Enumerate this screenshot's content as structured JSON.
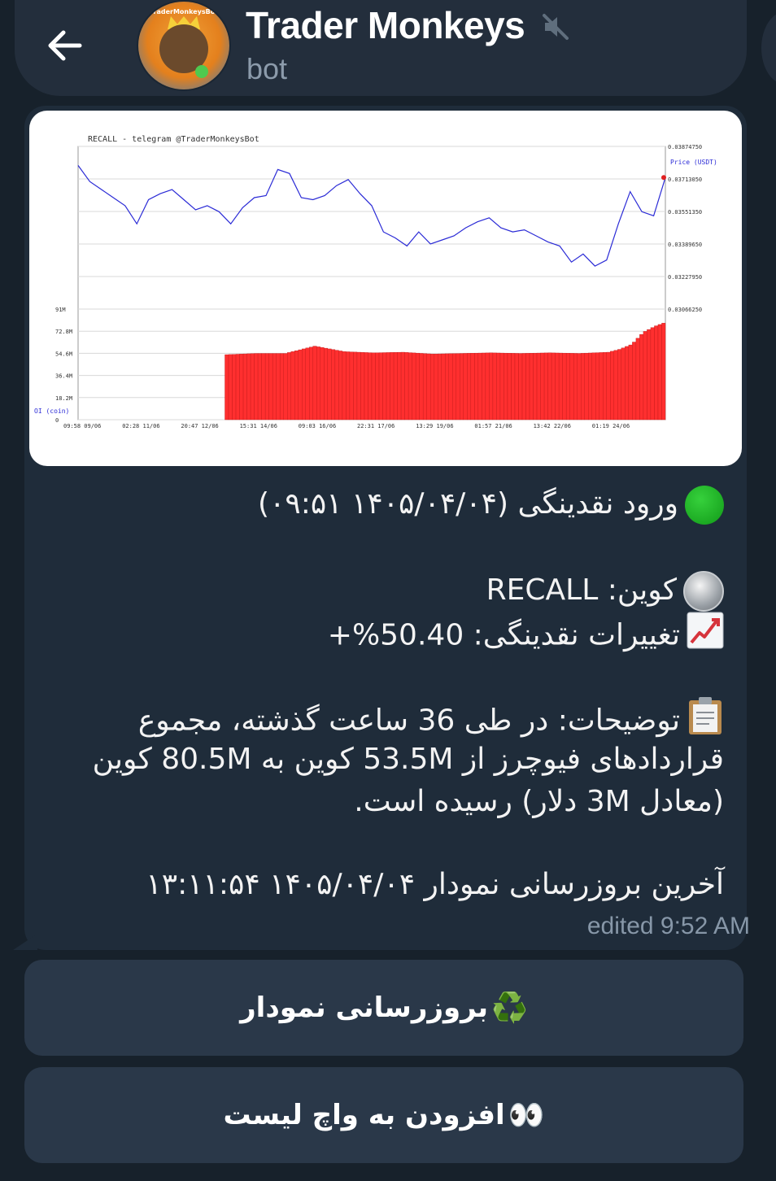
{
  "header": {
    "title": "Trader Monkeys",
    "subtitle": "bot",
    "avatar_text": "TraderMonkeysBot"
  },
  "chart": {
    "title": "RECALL - telegram @TraderMonkeysBot",
    "price_axis_label": "Price (USDT)",
    "oi_axis_label": "OI (coin)",
    "chart_data": {
      "type": "line",
      "title": "RECALL - telegram @TraderMonkeysBot",
      "price_ticks": [
        "0.03874750",
        "0.03713050",
        "0.03551350",
        "0.03389650",
        "0.03227950",
        "0.03066250"
      ],
      "oi_ticks": [
        "91M",
        "72.8M",
        "54.6M",
        "36.4M",
        "18.2M",
        "0"
      ],
      "x_ticks": [
        "09:58 09/06",
        "02:28 11/06",
        "20:47 12/06",
        "15:31 14/06",
        "09:03 16/06",
        "22:31 17/06",
        "13:29 19/06",
        "01:57 21/06",
        "13:42 22/06",
        "01:19 24/06"
      ],
      "price_range": [
        0.0306625,
        0.0387475
      ],
      "oi_range": [
        0,
        91
      ],
      "price_series": {
        "name": "Price (USDT)",
        "color": "#2b2bd6",
        "x": [
          0,
          2,
          4,
          6,
          8,
          10,
          12,
          14,
          16,
          18,
          20,
          22,
          24,
          26,
          28,
          30,
          32,
          34,
          36,
          38,
          40,
          42,
          44,
          46,
          48,
          50,
          52,
          54,
          56,
          58,
          60,
          62,
          64,
          66,
          68,
          70,
          72,
          74,
          76,
          78,
          80,
          82,
          84,
          86,
          88,
          90,
          92,
          94,
          96,
          98,
          100
        ],
        "y": [
          0.0378,
          0.037,
          0.0366,
          0.0362,
          0.0358,
          0.0349,
          0.0361,
          0.0364,
          0.0366,
          0.0361,
          0.0356,
          0.0358,
          0.0355,
          0.0349,
          0.0357,
          0.0362,
          0.0363,
          0.0376,
          0.0374,
          0.0362,
          0.0361,
          0.0363,
          0.0368,
          0.0371,
          0.0364,
          0.0358,
          0.0345,
          0.0342,
          0.0338,
          0.0345,
          0.0339,
          0.0341,
          0.0343,
          0.0347,
          0.035,
          0.0352,
          0.0347,
          0.0345,
          0.0346,
          0.0343,
          0.034,
          0.0338,
          0.033,
          0.0334,
          0.0328,
          0.0331,
          0.0349,
          0.0365,
          0.0355,
          0.0353,
          0.0372
        ]
      },
      "oi_series": {
        "name": "OI (coin)",
        "color": "#ff2f2f",
        "x": [
          25,
          30,
          35,
          40,
          45,
          50,
          55,
          60,
          65,
          70,
          75,
          80,
          85,
          90,
          92,
          94,
          96,
          98,
          100
        ],
        "y": [
          53.5,
          54.5,
          54.5,
          60.5,
          56.0,
          55.0,
          55.5,
          54.0,
          54.5,
          55.0,
          54.5,
          55.0,
          54.5,
          55.5,
          58.0,
          62.0,
          72.0,
          77.0,
          80.5
        ]
      }
    }
  },
  "message": {
    "line1": "ورود نقدینگی (۱۴۰۵/۰۴/۰۴ ۰۹:۵۱)",
    "coin_line": "کوین: RECALL",
    "change_line": "تغییرات نقدینگی: 50.40%+",
    "desc_1": "توضیحات: در طی 36 ساعت گذشته، مجموع",
    "desc_2": "قراردادهای فیوچرز از 53.5M کوین به 80.5M کوین",
    "desc_3": "(معادل 3M دلار) رسیده است.",
    "last_update": "آخرین بروزرسانی نمودار ۱۴۰۵/۰۴/۰۴ ۱۳:۱۱:۵۴",
    "edited": "edited 9:52 AM"
  },
  "keyboard": {
    "refresh_label": "بروزرسانی نمودار",
    "refresh_emoji": "♻️",
    "watch_label": "افزودن به واچ لیست",
    "watch_emoji": "👀"
  }
}
